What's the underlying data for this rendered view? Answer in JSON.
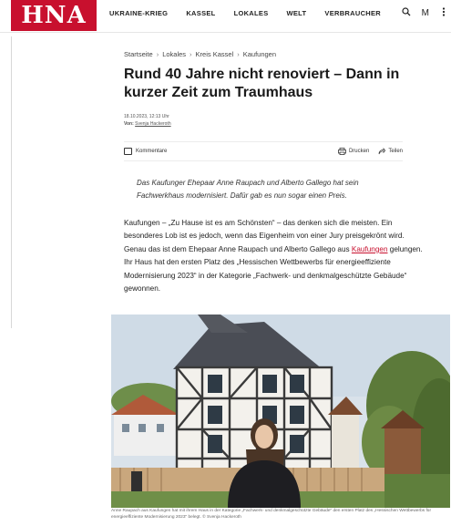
{
  "site": {
    "logo": "HNA"
  },
  "nav": {
    "items": [
      "UKRAINE-KRIEG",
      "KASSEL",
      "LOKALES",
      "WELT",
      "VERBRAUCHER"
    ],
    "icons": [
      "search-icon",
      "M",
      "menu-icon"
    ],
    "m_label": "M"
  },
  "breadcrumb": [
    "Startseite",
    "Lokales",
    "Kreis Kassel",
    "Kaufungen"
  ],
  "article": {
    "headline": "Rund 40 Jahre nicht renoviert – Dann in kurzer Zeit zum Traumhaus",
    "date": "18.10.2023, 12:13 Uhr",
    "author_prefix": "Von: ",
    "author": "Svenja Hackeroth",
    "comments_label": "Kommentare",
    "print_label": "Drucken",
    "share_label": "Teilen",
    "teaser": "Das Kaufunger Ehepaar Anne Raupach und Alberto Gallego hat sein Fachwerkhaus modernisiert. Dafür gab es nun sogar einen Preis.",
    "body_part1": "Kaufungen – „Zu Hause ist es am Schönsten“ – das denken sich die meisten. Ein besonderes Lob ist es jedoch, wenn das Eigenheim von einer Jury preisgekrönt wird. Genau das ist dem Ehepaar Anne Raupach und Alberto Gallego aus ",
    "body_link": "Kaufungen",
    "body_part2": " gelungen. Ihr Haus hat den ersten Platz des „Hessischen Wettbewerbs für energieeffiziente Modernisierung 2023“ in der Kategorie „Fachwerk- und denkmalgeschützte Gebäude“ gewonnen.",
    "caption": "Anne Raupach aus Kaufungen hat mit ihrem Haus in der Kategorie „Fachwerk- und denkmalgeschützte Gebäude“ den ersten Platz des „Hessischen Wettbewerbs für energieeffiziente Modernisierung 2023“ belegt. © Svenja Hackeroth"
  },
  "colors": {
    "brand": "#c8102e",
    "text": "#1a1a1a"
  }
}
